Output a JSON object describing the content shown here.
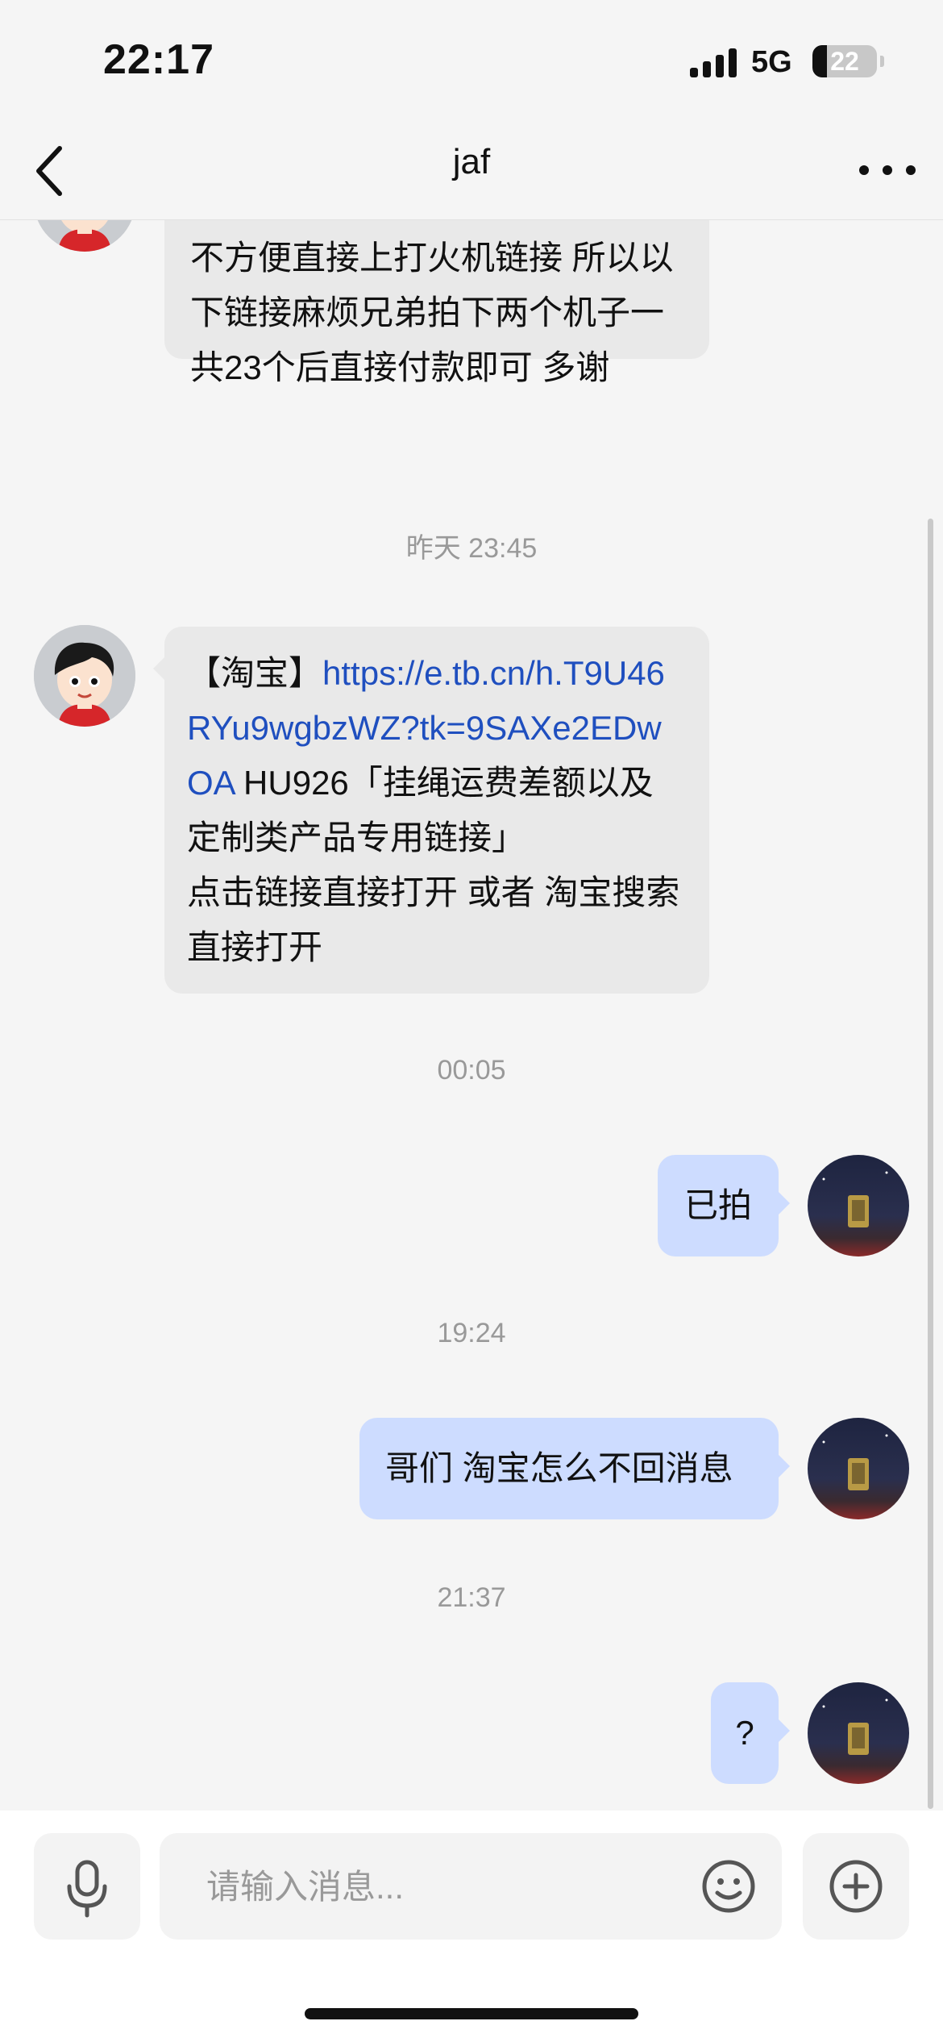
{
  "status_bar": {
    "time": "22:17",
    "network": "5G",
    "battery": "22",
    "battery_level": 0.22
  },
  "nav": {
    "title": "jaf",
    "back_icon": "chevron-left-icon",
    "more_icon": "more-horizontal-icon"
  },
  "messages": [
    {
      "side": "left",
      "text": "不方便直接上打火机链接   所以以下链接麻烦兄弟拍下两个机子一共23个后直接付款即可 多谢"
    },
    {
      "side": "left",
      "link": "https://e.tb.cn/h.T9U46RYu9wgbzWZ?tk=9SAXe2EDwOA",
      "text": " HU926「挂绳运费差额以及定制类产品专用链接」",
      "text2": "点击链接直接打开 或者 淘宝搜索直接打开",
      "prefix": "【淘宝】"
    },
    {
      "side": "right",
      "text": "已拍"
    },
    {
      "side": "right",
      "text": "哥们 淘宝怎么不回消息"
    },
    {
      "side": "right",
      "text": "?"
    }
  ],
  "timestamps": [
    "昨天 23:45",
    "00:05",
    "19:24",
    "21:37"
  ],
  "input": {
    "placeholder": "请输入消息..."
  },
  "colors": {
    "bubble_left": "#e9e9e9",
    "bubble_right": "#cddcff",
    "link": "#1f4fbf",
    "background": "#f5f5f5"
  }
}
